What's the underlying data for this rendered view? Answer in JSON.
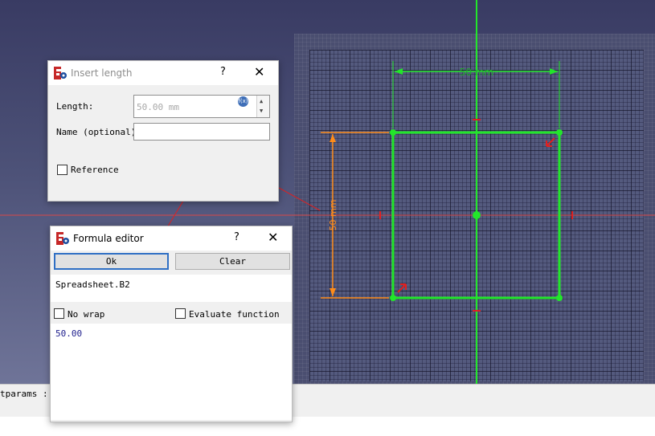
{
  "sketch": {
    "dimension_horizontal": "50 mm",
    "dimension_vertical": "50 mm"
  },
  "colors": {
    "constraint_green": "#22e62a",
    "dimension_orange": "#ff8c1a",
    "axis_red": "#d84848",
    "arrow_red": "#e02020"
  },
  "report_view": {
    "visible_text": "tparams : 1"
  },
  "insert_length_dialog": {
    "title": "Insert length",
    "help": "?",
    "close": "✕",
    "length_label": "Length:",
    "length_value": "50.00 mm",
    "fx_badge": "f(x)",
    "name_label": "Name (optional)",
    "name_value": "",
    "reference_label": "Reference",
    "reference_checked": false
  },
  "formula_editor_dialog": {
    "title": "Formula editor",
    "help": "?",
    "close": "✕",
    "ok_label": "Ok",
    "clear_label": "Clear",
    "expression": "Spreadsheet.B2",
    "no_wrap_label": "No wrap",
    "no_wrap_checked": false,
    "evaluate_label": "Evaluate function",
    "evaluate_checked": false,
    "result": "50.00"
  }
}
